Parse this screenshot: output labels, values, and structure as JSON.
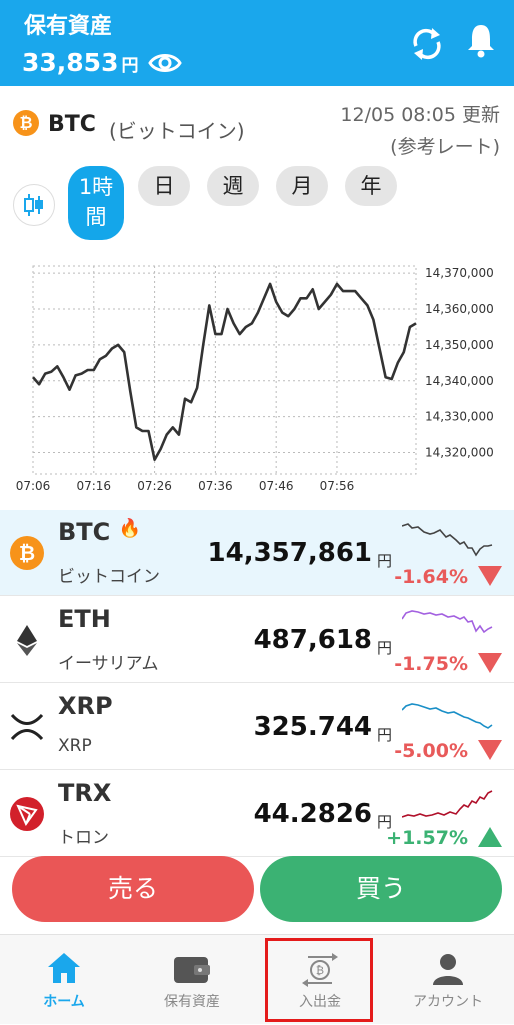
{
  "header": {
    "title": "保有資産",
    "amount": "33,853",
    "unit": "円",
    "icons": [
      "eye-icon",
      "sync-icon",
      "bell-icon"
    ]
  },
  "coin_head": {
    "symbol": "BTC",
    "name": "(ビットコイン)",
    "updated": "12/05 08:05 更新",
    "note": "(参考レート)"
  },
  "periods": {
    "active_line1": "1時",
    "active_line2": "間",
    "day": "日",
    "week": "週",
    "month": "月",
    "year": "年"
  },
  "chart_data": {
    "type": "line",
    "x_ticks": [
      "07:06",
      "07:16",
      "07:26",
      "07:36",
      "07:46",
      "07:56"
    ],
    "y_ticks": [
      "14,370,000",
      "14,360,000",
      "14,350,000",
      "14,340,000",
      "14,330,000",
      "14,320,000"
    ],
    "ylim": [
      14314000,
      14372000
    ],
    "grid": true,
    "series": [
      {
        "values": [
          14341000,
          14339000,
          14342000,
          14342500,
          14344000,
          14341000,
          14337500,
          14341500,
          14342000,
          14343000,
          14343000,
          14346000,
          14347000,
          14349000,
          14350000,
          14348000,
          14337000,
          14327000,
          14326000,
          14326000,
          14318000,
          14321000,
          14325000,
          14327000,
          14325000,
          14335000,
          14334000,
          14338000,
          14350000,
          14361000,
          14353000,
          14353000,
          14360000,
          14356000,
          14353000,
          14355000,
          14356000,
          14359000,
          14363000,
          14367000,
          14362000,
          14359000,
          14358000,
          14360000,
          14363000,
          14363000,
          14365500,
          14360000,
          14362000,
          14364000,
          14367000,
          14365000,
          14365000,
          14365000,
          14363000,
          14361000,
          14357000,
          14349000,
          14341000,
          14340500,
          14345000,
          14348000,
          14355000,
          14356000
        ]
      }
    ]
  },
  "coins": [
    {
      "symbol": "BTC",
      "name": "ビットコイン",
      "price": "14,357,861",
      "unit": "円",
      "change": "-1.64%",
      "hot": "🔥"
    },
    {
      "symbol": "ETH",
      "name": "イーサリアム",
      "price": "487,618",
      "unit": "円",
      "change": "-1.75%"
    },
    {
      "symbol": "XRP",
      "name": "XRP",
      "price": "325.744",
      "unit": "円",
      "change": "-5.00%"
    },
    {
      "symbol": "TRX",
      "name": "トロン",
      "price": "44.2826",
      "unit": "円",
      "change": "+1.57%"
    }
  ],
  "colors": {
    "brand": "#1aa7ec",
    "sell": "#ea5656",
    "buy": "#3bb273",
    "down": "#e85a5a",
    "up": "#3bb273",
    "highlight": "#e41b1b"
  },
  "actions": {
    "sell": "売る",
    "buy": "買う"
  },
  "nav": [
    {
      "label": "ホーム",
      "icon": "home-icon"
    },
    {
      "label": "保有資産",
      "icon": "wallet-icon"
    },
    {
      "label": "入出金",
      "icon": "deposit-withdraw-icon"
    },
    {
      "label": "アカウント",
      "icon": "account-icon"
    }
  ]
}
